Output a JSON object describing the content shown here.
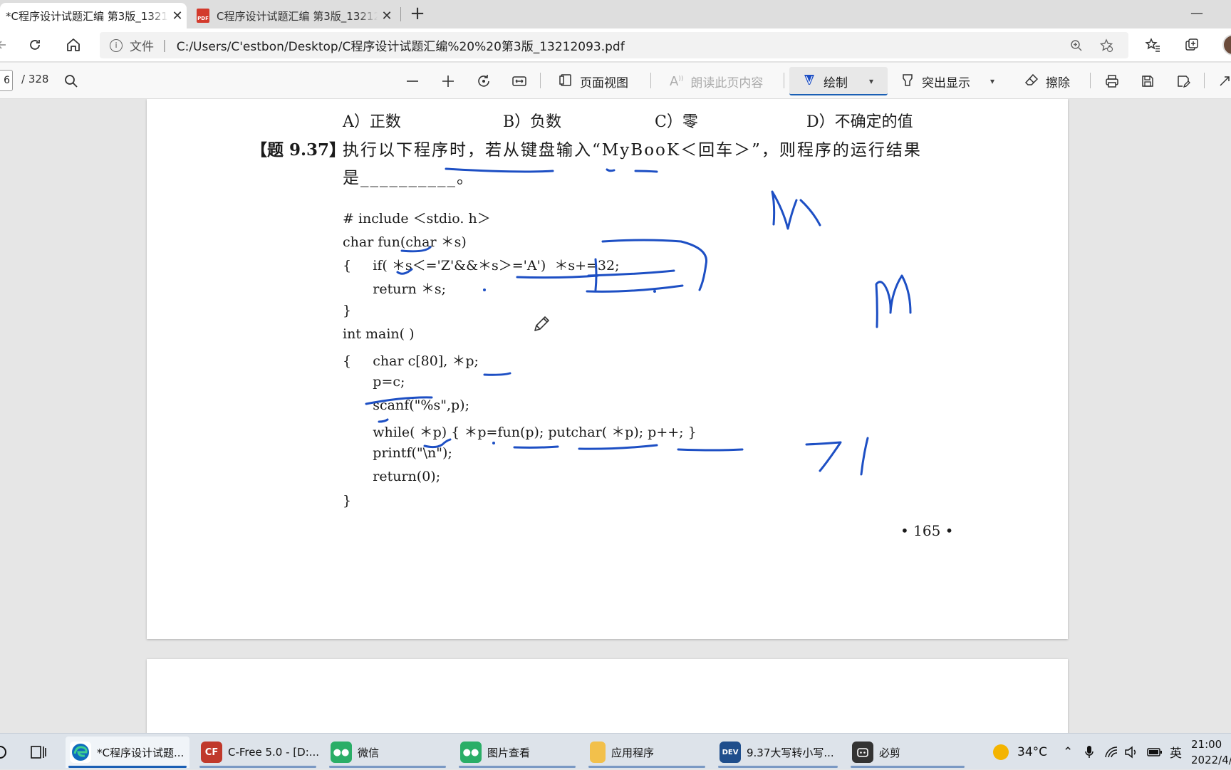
{
  "browser": {
    "tabs": [
      {
        "title": "*C程序设计试题汇编 第3版_13212093.pdf",
        "close": "✕"
      },
      {
        "title": "C程序设计试题汇编 第3版_13212093.pdf",
        "favicon": "PDF",
        "close": "✕"
      }
    ],
    "new_tab": "+",
    "minimize": "—",
    "address": {
      "info_glyph": "i",
      "label": "文件",
      "separator": "|",
      "url": "C:/Users/C'estbon/Desktop/C程序设计试题汇编%20%20第3版_13212093.pdf"
    }
  },
  "pdf_toolbar": {
    "page_current": "6",
    "page_total": "/ 328",
    "page_view": "页面视图",
    "read_aloud": "朗读此页内容",
    "draw": "绘制",
    "highlight": "突出显示",
    "erase": "擦除"
  },
  "document": {
    "options": {
      "a": "A）正数",
      "b": "B）负数",
      "c": "C）零",
      "d": "D）不确定的值"
    },
    "question": {
      "number": "【题 9.37】",
      "line1": "执行以下程序时，若从键盘输入“MyBooK＜回车＞”，则程序的运行结果",
      "line2": "是__________。"
    },
    "code_lines": [
      "# include ＜stdio. h＞",
      "char fun(char ＊s)",
      "{     if( ＊s＜='Z'&&＊s＞='A')  ＊s+=32;",
      "       return ＊s;",
      "}",
      "int main( )",
      "{     char c[80], ＊p;",
      "       p=c;",
      "       scanf(\"%s\",p);",
      "       while( ＊p) { ＊p=fun(p); putchar( ＊p); p++; }",
      "       printf(\"\\n\");",
      "       return(0);",
      "}"
    ],
    "page_number": "• 165 •"
  },
  "taskbar": {
    "apps": [
      {
        "label": "*C程序设计试题...",
        "icon": "edge-icon",
        "color": "#0f6cbd"
      },
      {
        "label": "C-Free 5.0 - [D:...",
        "icon": "cfree-icon",
        "color": "#c0392b"
      },
      {
        "label": "微信",
        "icon": "wechat-icon",
        "color": "#2aae67"
      },
      {
        "label": "图片查看",
        "icon": "wechat-photo-icon",
        "color": "#2aae67"
      },
      {
        "label": "应用程序",
        "icon": "folder-icon",
        "color": "#f2c04b"
      },
      {
        "label": "9.37大写转小写...",
        "icon": "dev-cpp-icon",
        "color": "#1f4e8c"
      },
      {
        "label": "必剪",
        "icon": "bijian-icon",
        "color": "#333333"
      }
    ],
    "weather": "34°C",
    "ime": "英",
    "time": "21:00",
    "date": "2022/4/"
  },
  "colors": {
    "ink": "#1d4fc4",
    "accent": "#1a5fb4"
  }
}
